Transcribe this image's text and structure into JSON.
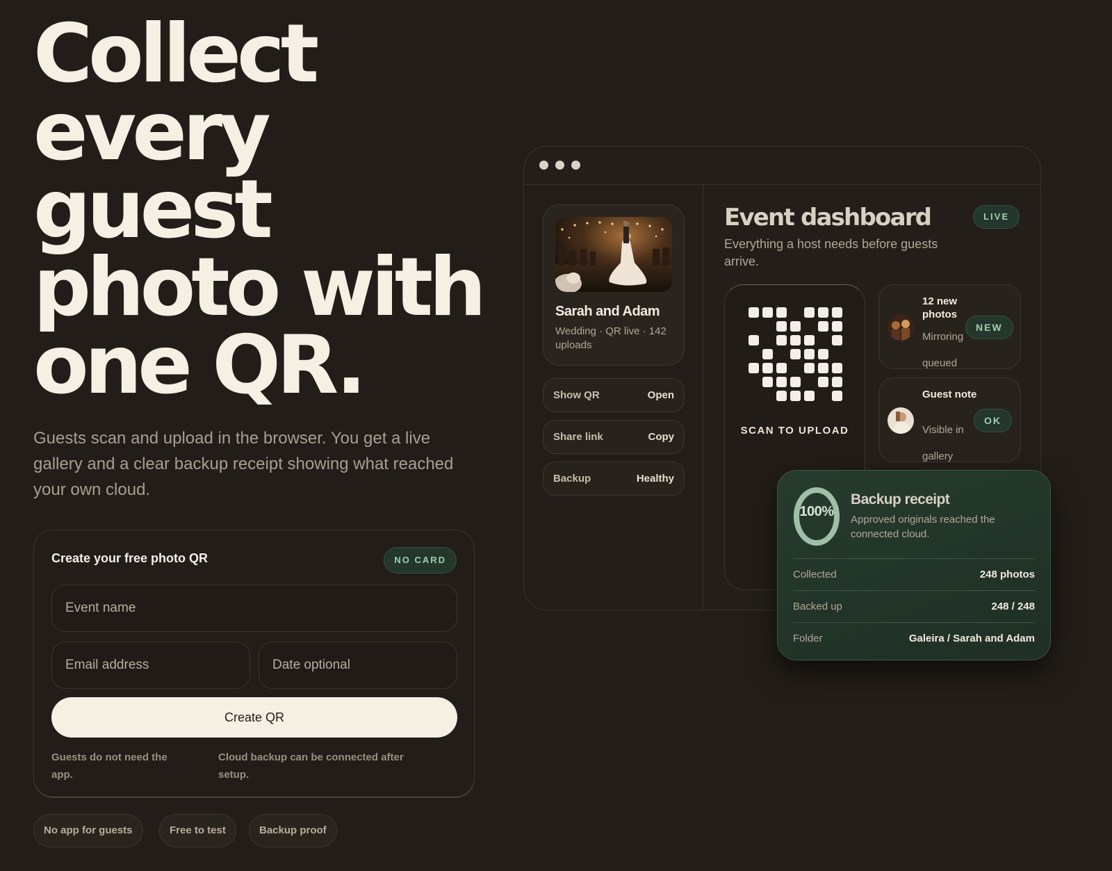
{
  "hero": {
    "title_lines": [
      "Collect",
      "every",
      "guest",
      "photo with",
      "one QR."
    ],
    "subtitle": "Guests scan and upload in the browser. You get a live gallery and a clear backup receipt showing what reached your own cloud."
  },
  "form": {
    "title": "Create your free photo QR",
    "badge": "NO CARD",
    "event_name_placeholder": "Event name",
    "email_placeholder": "Email address",
    "date_placeholder": "Date optional",
    "submit_label": "Create QR",
    "note_left": "Guests do not need the app.",
    "note_right": "Cloud backup can be connected after setup."
  },
  "chips": [
    "No app for guests",
    "Free to test",
    "Backup proof"
  ],
  "dashboard": {
    "event": {
      "name": "Sarah and Adam",
      "meta": "Wedding · QR live · 142 uploads"
    },
    "side_buttons": [
      {
        "label": "Show QR",
        "action": "Open"
      },
      {
        "label": "Share link",
        "action": "Copy"
      },
      {
        "label": "Backup",
        "action": "Healthy"
      }
    ],
    "title": "Event dashboard",
    "subtitle": "Everything a host needs before guests arrive.",
    "live_badge": "LIVE",
    "qr_label": "SCAN TO UPLOAD",
    "notifications": [
      {
        "title": "12 new photos",
        "subtitle": "Mirroring queued",
        "badge": "NEW"
      },
      {
        "title": "Guest note",
        "subtitle": "Visible in gallery",
        "badge": "OK"
      }
    ]
  },
  "receipt": {
    "percent": "100%",
    "percent_value": 100,
    "title": "Backup receipt",
    "subtitle": "Approved originals reached the connected cloud.",
    "rows": [
      {
        "key": "Collected",
        "value": "248 photos"
      },
      {
        "key": "Backed up",
        "value": "248 / 248"
      },
      {
        "key": "Folder",
        "value": "Galeira / Sarah and Adam"
      }
    ]
  },
  "colors": {
    "background": "#221d18",
    "accent_green": "#9fcfae",
    "badge_green_bg": "#24372c",
    "cream": "#f6f0e4"
  }
}
